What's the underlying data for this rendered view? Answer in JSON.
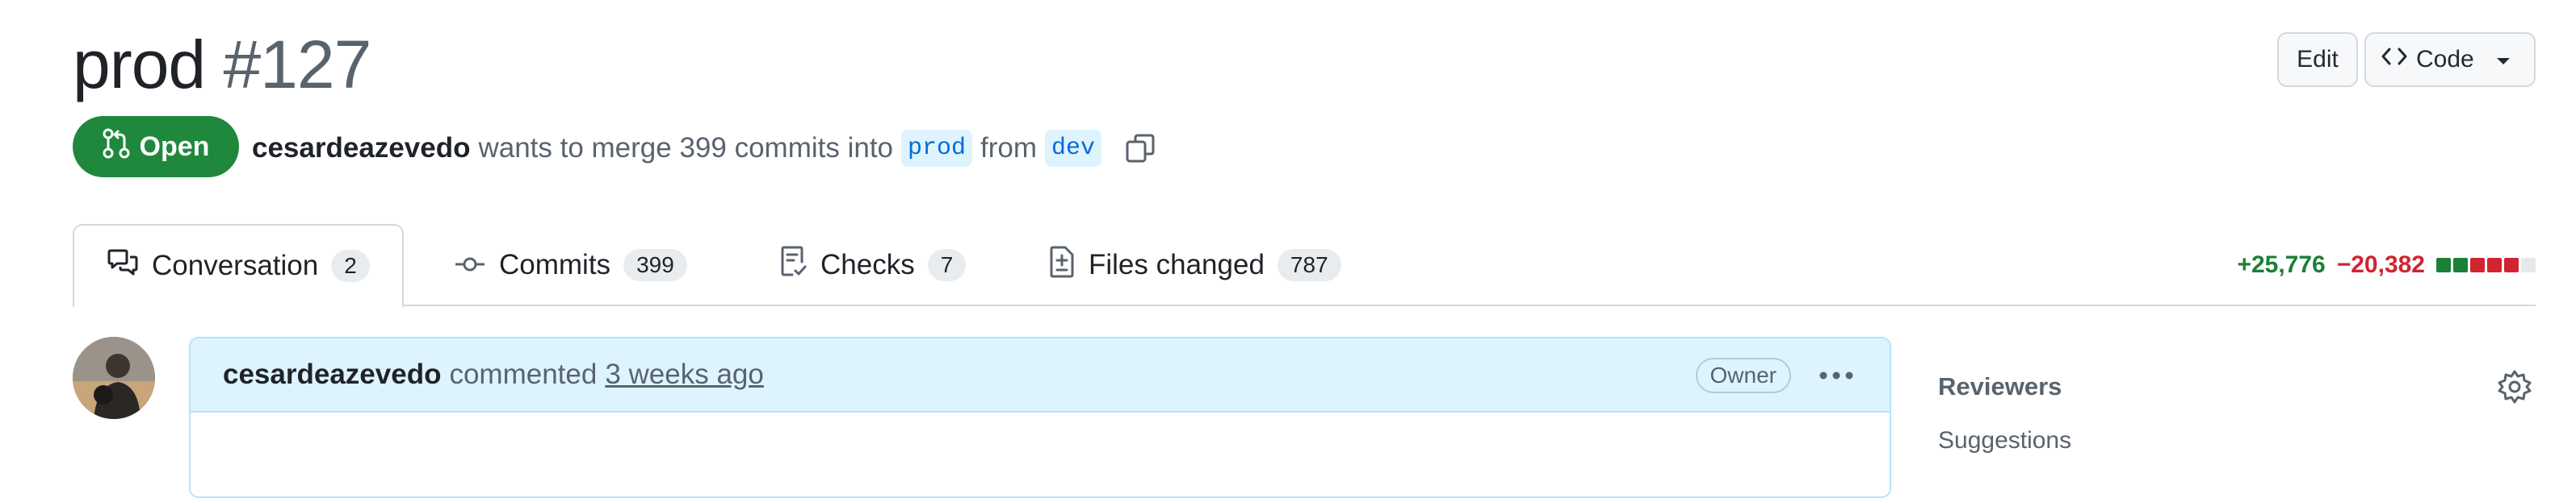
{
  "header": {
    "title": "prod",
    "number": "#127",
    "edit_label": "Edit",
    "code_label": "Code"
  },
  "pr_meta": {
    "state": "Open",
    "author": "cesardeazevedo",
    "text_before": "wants to merge 399 commits into",
    "base_branch": "prod",
    "text_from": "from",
    "head_branch": "dev"
  },
  "tabs": [
    {
      "label": "Conversation",
      "count": "2",
      "icon": "comment-discussion-icon"
    },
    {
      "label": "Commits",
      "count": "399",
      "icon": "git-commit-icon"
    },
    {
      "label": "Checks",
      "count": "7",
      "icon": "checklist-icon"
    },
    {
      "label": "Files changed",
      "count": "787",
      "icon": "file-diff-icon"
    }
  ],
  "diffstat": {
    "additions": "+25,776",
    "deletions": "−20,382",
    "blocks": [
      "#1a7f37",
      "#1a7f37",
      "#d1242f",
      "#d1242f",
      "#d1242f",
      "#e6e8eb"
    ]
  },
  "comment": {
    "author": "cesardeazevedo",
    "action": "commented",
    "time": "3 weeks ago",
    "badge": "Owner"
  },
  "sidebar": {
    "reviewers_title": "Reviewers",
    "suggestions": "Suggestions"
  },
  "colors": {
    "open_green": "#1f883d",
    "link_blue": "#0969da",
    "comment_header_bg": "#ddf4ff"
  }
}
